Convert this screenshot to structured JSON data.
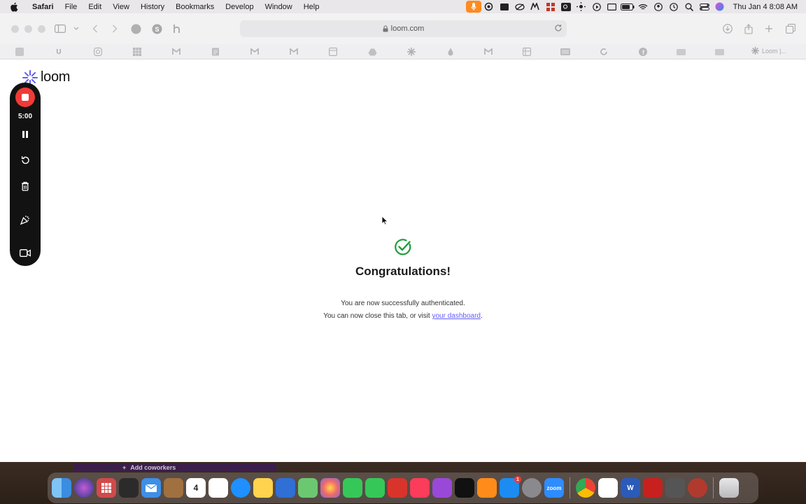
{
  "menubar": {
    "app_name": "Safari",
    "items": [
      "File",
      "Edit",
      "View",
      "History",
      "Bookmarks",
      "Develop",
      "Window",
      "Help"
    ],
    "clock": "Thu Jan 4  8:08 AM"
  },
  "toolbar": {
    "url": "loom.com"
  },
  "favorites": {
    "u_label": "U",
    "last_label": "Loom |..."
  },
  "page": {
    "logo_text": "loom",
    "recorder": {
      "timer": "5:00"
    },
    "success": {
      "title": "Congratulations!",
      "line1": "You are now successfully authenticated.",
      "line2_prefix": "You can now close this tab, or visit ",
      "link_text": "your dashboard",
      "line2_suffix": "."
    }
  },
  "bottom": {
    "coworkers_label": "Add coworkers"
  },
  "dock": {
    "calendar_day": "4",
    "zoom_label": "zoom",
    "appstore_badge": "1"
  },
  "colors": {
    "accent_purple": "#625df5",
    "record_red": "#f03a36",
    "success_green": "#1f9d3a",
    "loom_brand": "#625df5"
  }
}
